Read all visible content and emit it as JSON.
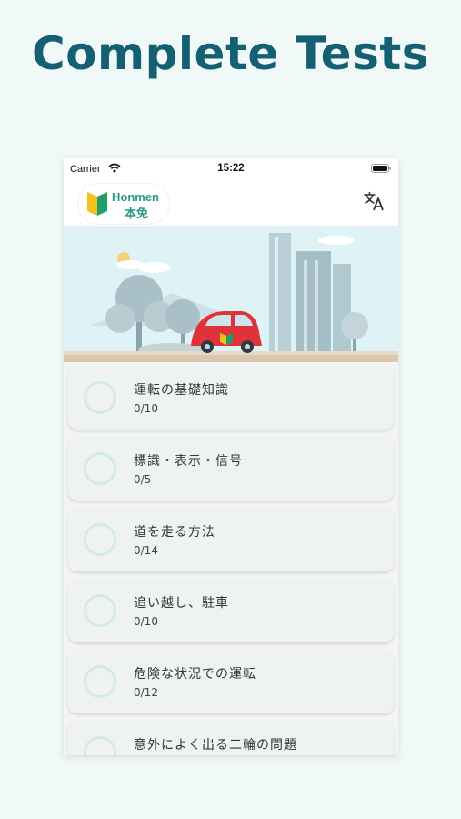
{
  "headline": "Complete Tests",
  "status_bar": {
    "carrier": "Carrier",
    "time": "15:22"
  },
  "app": {
    "logo_en": "Honmen",
    "logo_ja": "本免",
    "translate_icon": "translate-icon"
  },
  "lessons": [
    {
      "title": "運転の基礎知識",
      "progress": "0/10"
    },
    {
      "title": "標識・表示・信号",
      "progress": "0/5"
    },
    {
      "title": "道を走る方法",
      "progress": "0/14"
    },
    {
      "title": "追い越し、駐車",
      "progress": "0/10"
    },
    {
      "title": "危険な状況での運転",
      "progress": "0/12"
    },
    {
      "title": "意外によく出る二輪の問題",
      "progress": ""
    }
  ],
  "colors": {
    "accent": "#2a9a86",
    "headline": "#155f73",
    "car": "#e0323a"
  }
}
